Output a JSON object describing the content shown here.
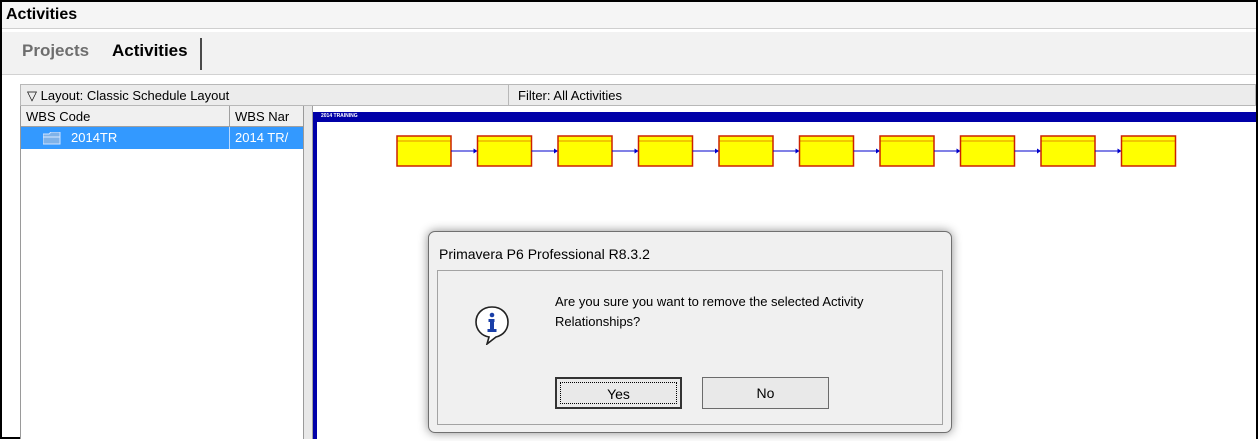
{
  "window": {
    "title": "Activities"
  },
  "tabs": [
    {
      "label": "Projects",
      "active": false
    },
    {
      "label": "Activities",
      "active": true
    }
  ],
  "toolbar": {
    "layout_label": "Layout: Classic Schedule Layout",
    "filter_label": "Filter: All Activities"
  },
  "wbs_table": {
    "columns": [
      "WBS Code",
      "WBS Nar"
    ],
    "rows": [
      {
        "code": "2014TR",
        "name": "2014 TR/",
        "selected": true
      }
    ]
  },
  "network": {
    "label": "2014 TRAINING",
    "activity_count": 10,
    "box_color": "#ffff00",
    "box_border": "#cc2200",
    "link_color": "#0000cc"
  },
  "dialog": {
    "title": "Primavera P6 Professional R8.3.2",
    "message": "Are you sure you want to remove the selected Activity Relationships?",
    "icon": "info-icon",
    "buttons": {
      "yes": "Yes",
      "no": "No"
    }
  }
}
